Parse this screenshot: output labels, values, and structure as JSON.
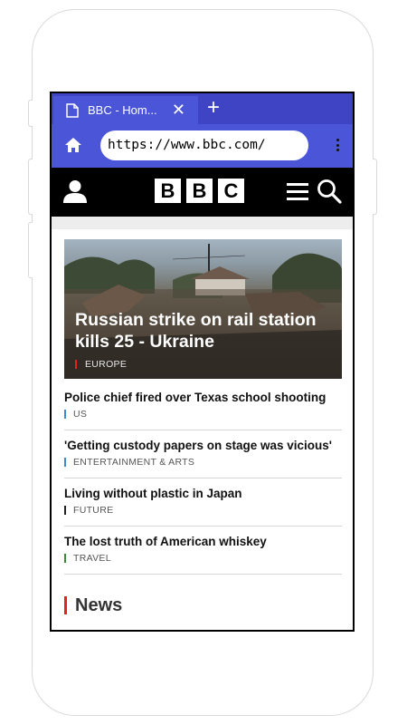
{
  "browser": {
    "tab_title": "BBC - Hom...",
    "tab_close": "✕",
    "new_tab": "+",
    "url": "https://www.bbc.com/"
  },
  "site": {
    "logo_letters": [
      "B",
      "B",
      "C"
    ]
  },
  "hero": {
    "title": "Russian strike on rail station kills 25 - Ukraine",
    "category": "EUROPE",
    "category_color": "#e2241c"
  },
  "stories": [
    {
      "title": "Police chief fired over Texas school shooting",
      "category": "US",
      "category_color": "#3a8bd1"
    },
    {
      "title": "'Getting custody papers on stage was vicious'",
      "category": "ENTERTAINMENT & ARTS",
      "category_color": "#3a8bd1"
    },
    {
      "title": "Living without plastic in Japan",
      "category": "FUTURE",
      "category_color": "#222222"
    },
    {
      "title": "The lost truth of American whiskey",
      "category": "TRAVEL",
      "category_color": "#3a8a3a"
    }
  ],
  "section": {
    "title": "News",
    "accent": "#e2241c"
  },
  "colors": {
    "browser_bar": "#4a55d8",
    "tab_strip": "#3f44c4",
    "header_bg": "#000000"
  }
}
